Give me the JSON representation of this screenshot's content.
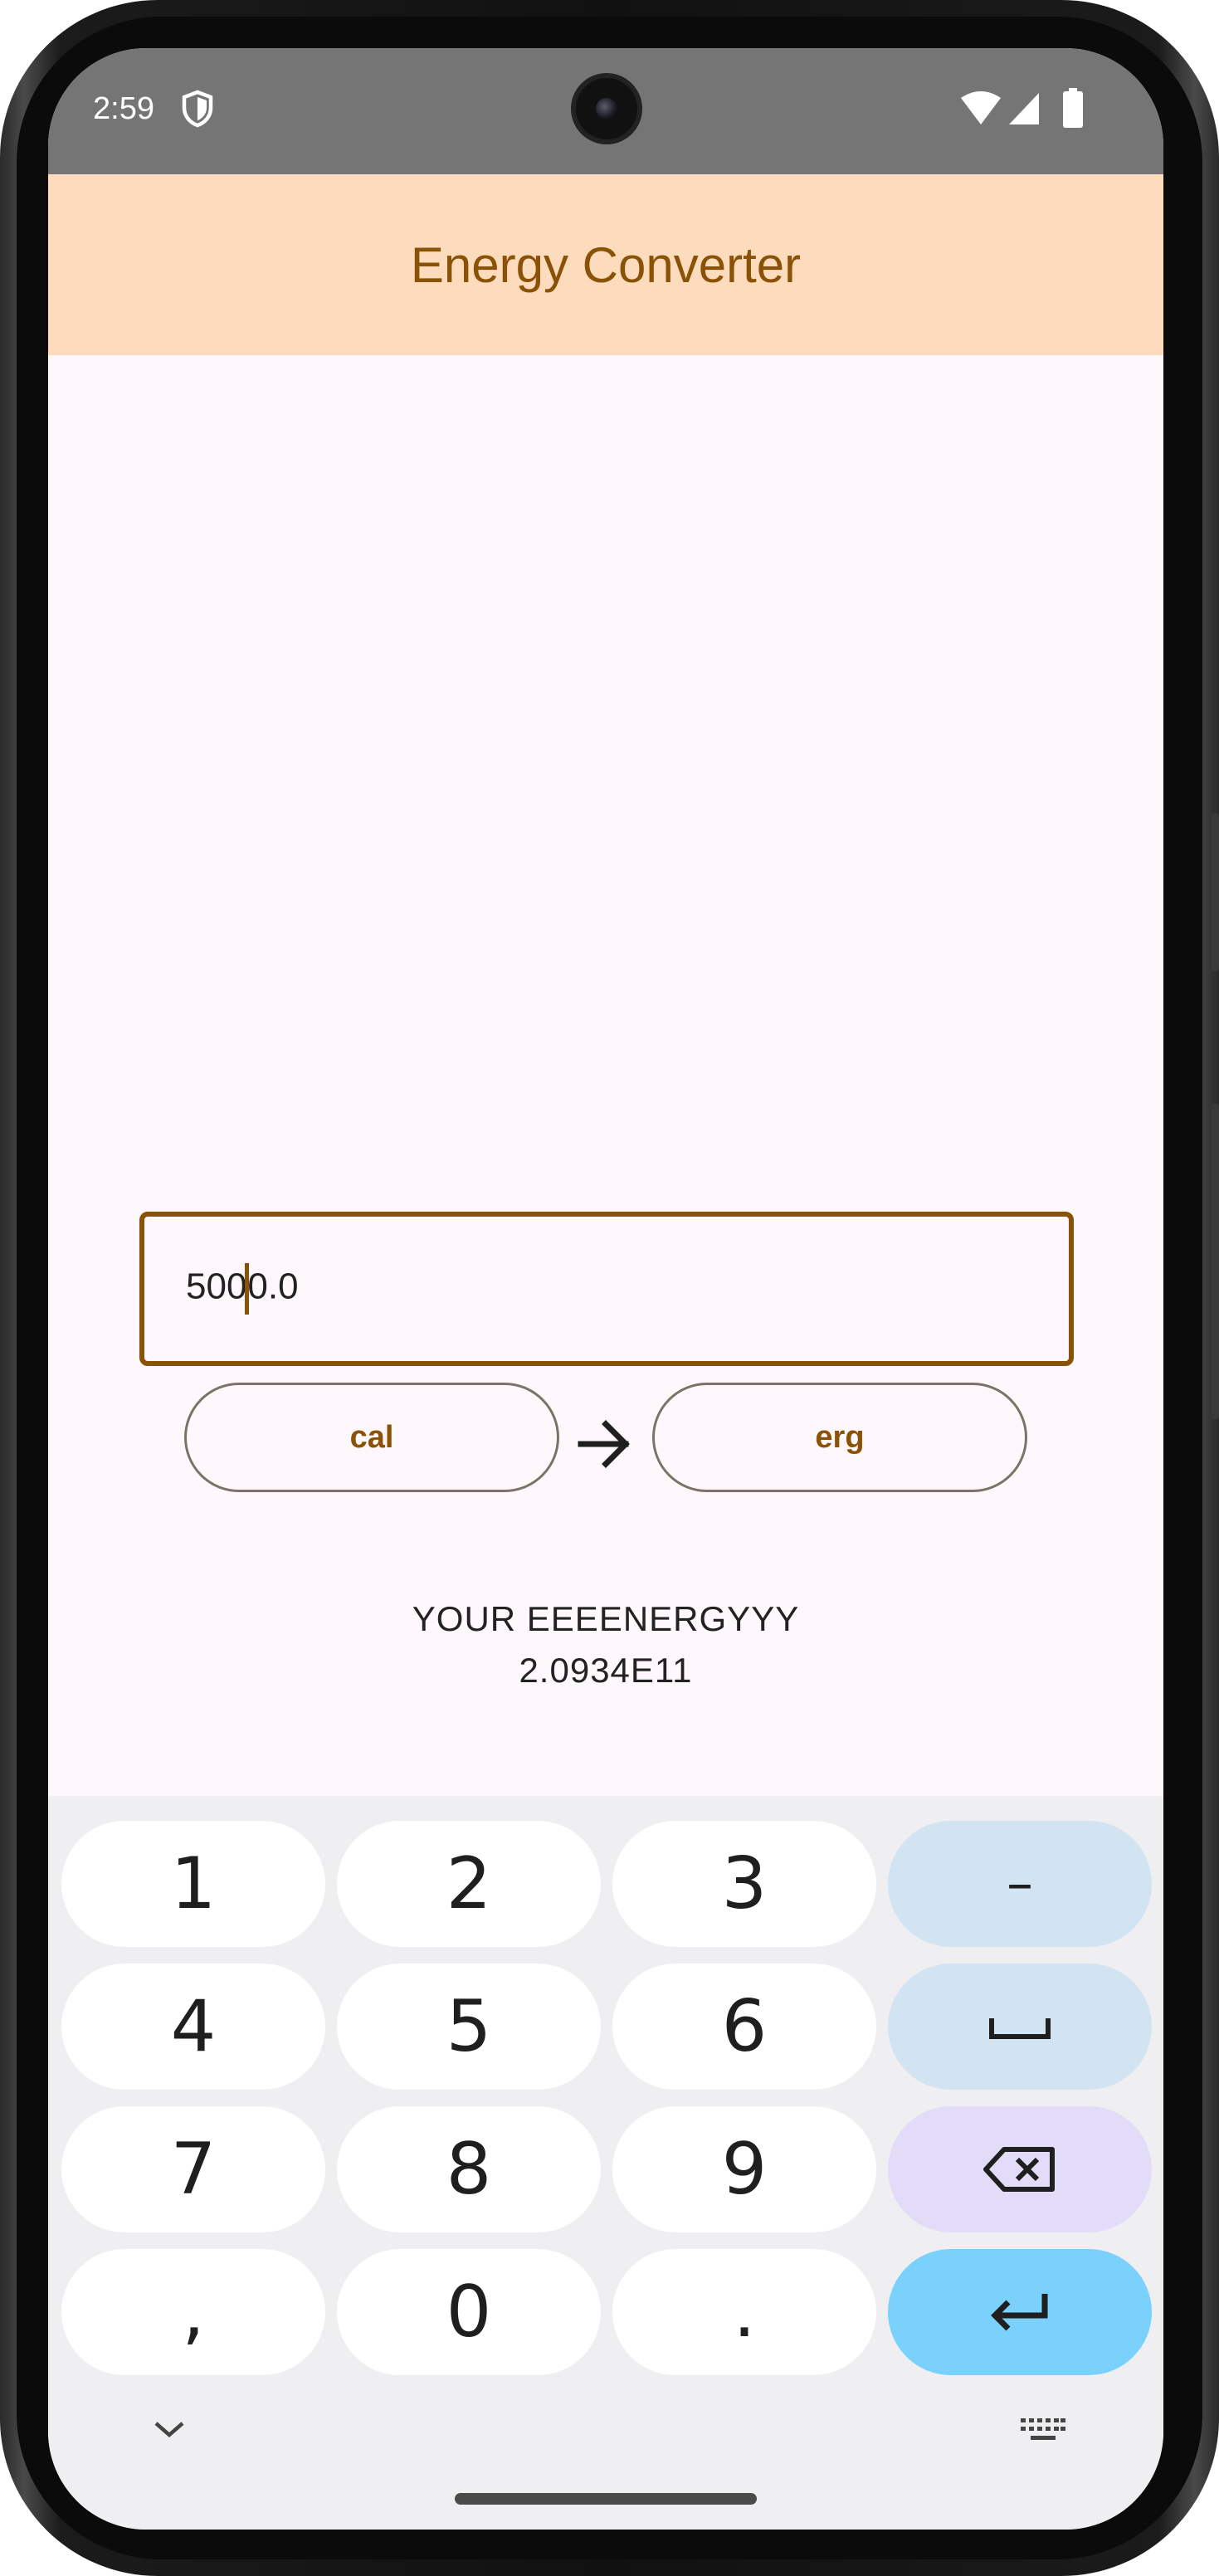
{
  "status_bar": {
    "time": "2:59",
    "icons": [
      "shield-icon",
      "wifi-icon",
      "signal-icon",
      "battery-icon"
    ]
  },
  "app_bar": {
    "title": "Energy Converter"
  },
  "converter": {
    "input_value": "5000.0",
    "from_unit": "cal",
    "to_unit": "erg",
    "result_label": "YOUR EEEENERGYYY",
    "result_value": "2.0934E11"
  },
  "keyboard": {
    "rows": [
      [
        "1",
        "2",
        "3",
        "–"
      ],
      [
        "4",
        "5",
        "6",
        "space-icon"
      ],
      [
        "7",
        "8",
        "9",
        "backspace-icon"
      ],
      [
        ",",
        "0",
        ".",
        "enter-icon"
      ]
    ],
    "bottom_icons": [
      "chevron-down-icon",
      "keyboard-icon"
    ]
  },
  "colors": {
    "accent": "#8a5206",
    "app_bar": "#fcdcbd",
    "status_bar": "#757575",
    "key_blue": "#d2e3f1",
    "key_purple": "#e3dcf9",
    "key_enter": "#7ad1fc"
  }
}
